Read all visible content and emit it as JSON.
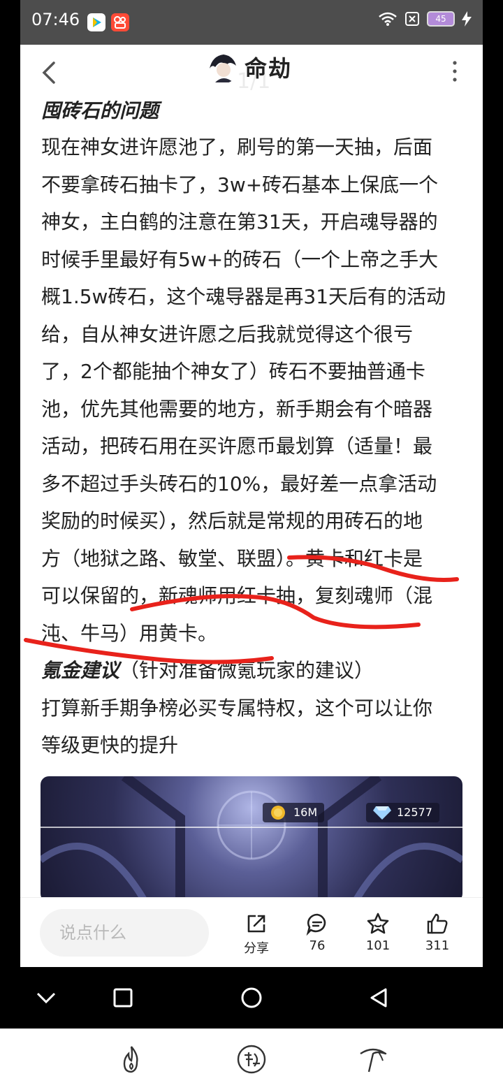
{
  "status_bar": {
    "time": "07:46",
    "battery": "45"
  },
  "header": {
    "title": "命劫",
    "ghost_page": "1/1"
  },
  "article": {
    "lines": [
      "现在神女进许愿池了，刷号的第一天抽，后面",
      "不要拿砖石抽卡了，3w+砖石基本上保底一个",
      "神女，主白鹤的注意在第31天，开启魂导器的",
      "时候手里最好有5w+的砖石（一个上帝之手大",
      "概1.5w砖石，这个魂导器是再31天后有的活动",
      "给，自从神女进许愿之后我就觉得这个很亏",
      "了，2个都能抽个神女了）砖石不要抽普通卡",
      "池，优先其他需要的地方，新手期会有个暗器",
      "活动，把砖石用在买许愿币最划算（适量！最",
      "多不超过手头砖石的10%，最好差一点拿活动",
      "奖励的时候买），然后就是常规的用砖石的地",
      "方（地狱之路、敏堂、联盟）。黄卡和红卡是",
      "可以保留的，新魂师用红卡抽，复刻魂师（混",
      "沌、牛马）用黄卡。"
    ],
    "section_heading_top": "囤砖石的问题",
    "section_heading_2": "氪金建议",
    "section_heading_2_sub": "（针对准备微氪玩家的建议）",
    "tail_lines": [
      "打算新手期争榜必买专属特权，这个可以让你",
      "等级更快的提升"
    ]
  },
  "game_hud": {
    "coins": "16M",
    "diamonds": "12577"
  },
  "action_bar": {
    "comment_placeholder": "说点什么",
    "share_label": "分享",
    "comments_count": "76",
    "favorites_count": "101",
    "likes_count": "311"
  },
  "colors": {
    "accent_red": "#e8221b",
    "text": "#222222",
    "statusbar_bg": "#4d4d4d"
  }
}
